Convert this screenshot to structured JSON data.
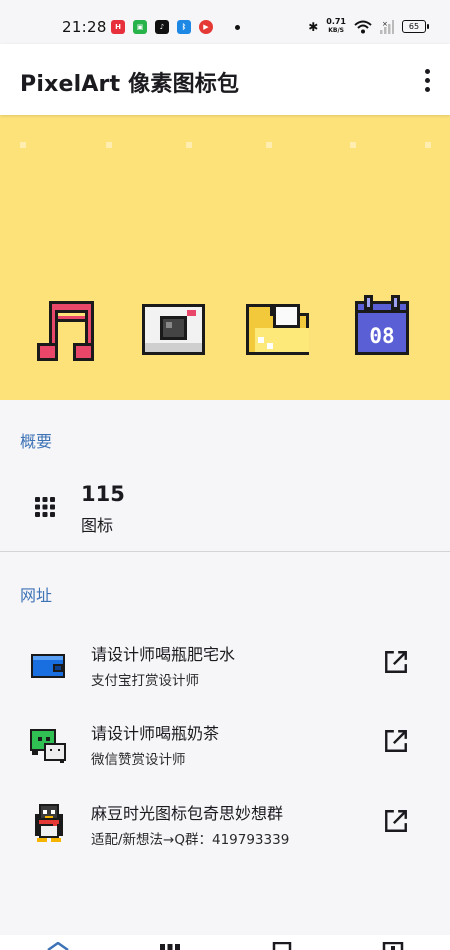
{
  "status_bar": {
    "time": "21:28",
    "speed_value": "0.71",
    "speed_unit": "KB/S",
    "battery": "65"
  },
  "app_bar": {
    "title": "PixelArt 像素图标包"
  },
  "banner": {
    "background_color": "#fde27a",
    "icons": [
      "music-note-icon",
      "camera-icon",
      "folder-icon",
      "calendar-icon"
    ],
    "calendar_text": "08"
  },
  "overview": {
    "section_label": "概要",
    "count": "115",
    "count_label": "图标"
  },
  "links": {
    "section_label": "网址",
    "items": [
      {
        "icon": "wallet-icon",
        "title": "请设计师喝瓶肥宅水",
        "subtitle": "支付宝打赏设计师"
      },
      {
        "icon": "wechat-icon",
        "title": "请设计师喝瓶奶茶",
        "subtitle": "微信赞赏设计师"
      },
      {
        "icon": "qq-penguin-icon",
        "title": "麻豆时光图标包奇思妙想群",
        "subtitle": "适配/新想法→Q群：419793339"
      }
    ]
  },
  "colors": {
    "accent": "#3e73b6",
    "banner": "#fde27a"
  }
}
